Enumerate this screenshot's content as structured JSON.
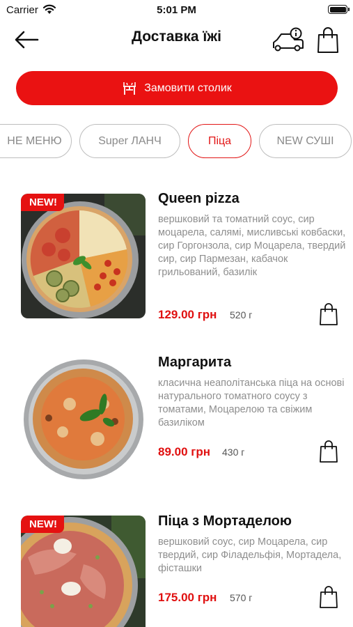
{
  "status_bar": {
    "carrier": "Carrier",
    "time": "5:01 PM"
  },
  "header": {
    "title": "Доставка їжі",
    "icons": {
      "back": "arrow-left-icon",
      "delivery_info": "delivery-car-info-icon",
      "cart": "shopping-bag-icon"
    }
  },
  "reserve_button": {
    "label": "Замовити столик",
    "icon": "restaurant-table-icon"
  },
  "tabs": [
    {
      "label": "НЕ МЕНЮ",
      "active": false
    },
    {
      "label": "Super ЛАНЧ",
      "active": false
    },
    {
      "label": "Піца",
      "active": true
    },
    {
      "label": "NEW СУШІ",
      "active": false
    }
  ],
  "products": [
    {
      "name": "Queen pizza",
      "badge": "NEW!",
      "description": "вершковий та томатний соус, сир моцарела, салямі, мисливські ковбаски, сир Горгонзола, сир Моцарела, твердий сир, сир Пармезан, кабачок грильований, базилік",
      "price": "129.00 грн",
      "weight": "520 г"
    },
    {
      "name": "Маргарита",
      "badge": "",
      "description": "класична неаполітанська піца на основі натурального томатного соусу з томатами, Моцарелою та свіжим базиліком",
      "price": "89.00 грн",
      "weight": "430 г"
    },
    {
      "name": "Піца з Мортаделою",
      "badge": "NEW!",
      "description": "вершковий соус, сир Моцарела, сир твердий, сир Філадельфія, Мортадела, фісташки",
      "price": "175.00 грн",
      "weight": "570 г"
    }
  ],
  "colors": {
    "accent": "#ea1212",
    "text": "#111111",
    "muted": "#8e8e8e",
    "tab_border": "#bdbdbd"
  }
}
